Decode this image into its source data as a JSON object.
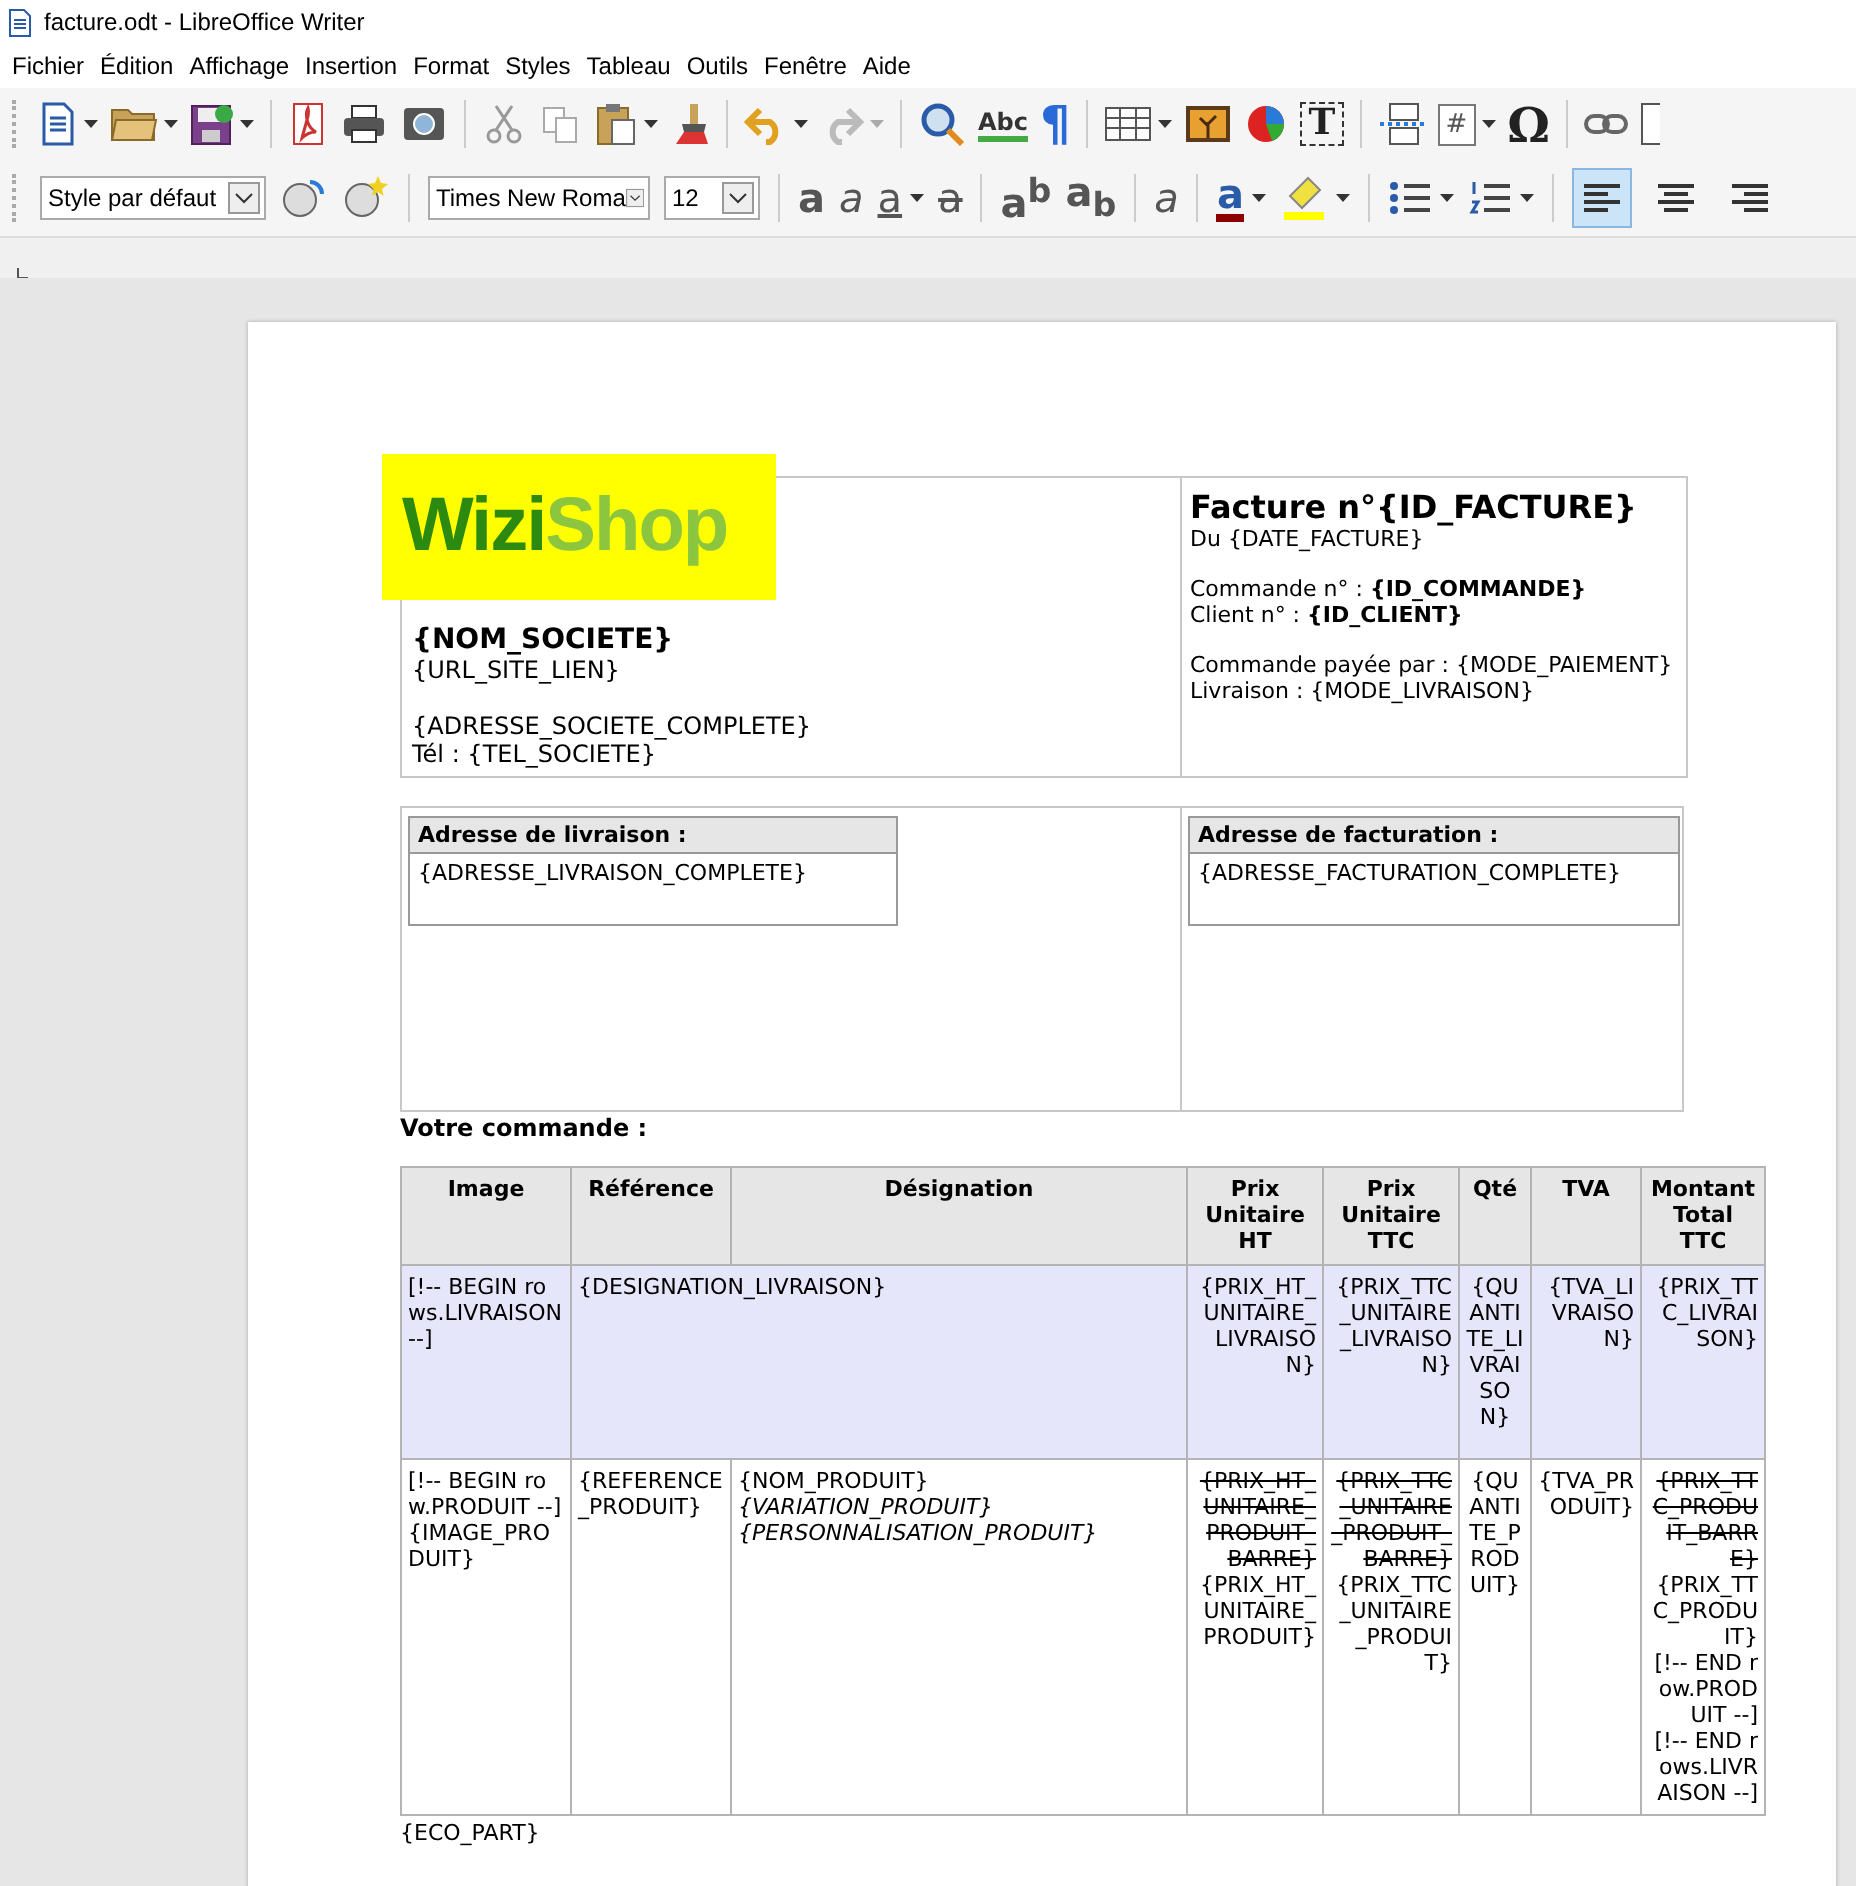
{
  "window": {
    "title": "facture.odt - LibreOffice Writer"
  },
  "menu": [
    "Fichier",
    "Édition",
    "Affichage",
    "Insertion",
    "Format",
    "Styles",
    "Tableau",
    "Outils",
    "Fenêtre",
    "Aide"
  ],
  "standard_toolbar": {
    "spellcheck": "Abc",
    "formatting_marks": "¶",
    "text_box": "T",
    "field": "#",
    "special_character": "Ω"
  },
  "formatting_toolbar": {
    "paragraph_style": "Style par défaut",
    "font_name": "Times New Roma",
    "font_size": "12",
    "text_buttons": [
      {
        "kind": "bold",
        "label": "a"
      },
      {
        "kind": "italic",
        "label": "a"
      },
      {
        "kind": "underline",
        "label": "a"
      },
      {
        "kind": "strike",
        "label": "a"
      }
    ],
    "script_buttons": [
      {
        "label": "a$^{b}$"
      },
      {
        "label": "a$_{b}$"
      }
    ],
    "clear_label": "a",
    "font_color_label": "a",
    "alignment": [
      {
        "selected": true
      },
      {
        "selected": false
      },
      {
        "selected": false
      }
    ]
  },
  "document": {
    "logo": {
      "part_1": "Wizi",
      "part_2": "Shop"
    },
    "company": {
      "name": "{NOM_SOCIETE}",
      "url": "{URL_SITE_LIEN}",
      "address": "{ADRESSE_SOCIETE_COMPLETE}",
      "phone": "Tél : {TEL_SOCIETE}"
    },
    "invoice": {
      "title": "Facture n°{ID_FACTURE}",
      "date": "Du  {DATE_FACTURE}",
      "order": "Commande n° : **{ID_COMMANDE}**",
      "client": "Client n° : **{ID_CLIENT}**",
      "payment": "Commande payée par : {MODE_PAIEMENT}",
      "shipping": "Livraison : {MODE_LIVRAISON}"
    },
    "addresses": [
      {
        "title": "Adresse de livraison :",
        "content": "{ADRESSE_LIVRAISON_COMPLETE}"
      },
      {
        "title": "Adresse de facturation :",
        "content": "{ADRESSE_FACTURATION_COMPLETE}"
      }
    ],
    "order_heading": "Votre commande :",
    "table": {
      "columns": [
        "Image",
        "Référence",
        "Désignation",
        "Prix Unitaire HT",
        "Prix Unitaire TTC",
        "Qté",
        "TVA",
        "Montant Total TTC"
      ],
      "rows": [
        {
          "shaded": true,
          "cells": [
            {
              "kind": "normal",
              "lines": [
                {
                  "kind": "plain",
                  "text": "[!-- BEGIN rows.LIVRAISON --]"
                }
              ]
            },
            {
              "kind": "normal",
              "colspan": 2,
              "lines": [
                {
                  "kind": "plain",
                  "text": "{DESIGNATION_LIVRAISON}"
                }
              ]
            },
            {
              "kind": "normal",
              "lines": [
                {
                  "kind": "plain",
                  "text": "{PRIX_HT_UNITAIRE_LIVRAISON}"
                }
              ]
            },
            {
              "kind": "normal",
              "lines": [
                {
                  "kind": "plain",
                  "text": "{PRIX_TTC_UNITAIRE_LIVRAISON}"
                }
              ]
            },
            {
              "kind": "normal",
              "lines": [
                {
                  "kind": "plain",
                  "text": "{QUANTITE_LIVRAISON}"
                }
              ]
            },
            {
              "kind": "normal",
              "lines": [
                {
                  "kind": "plain",
                  "text": "{TVA_LIVRAISON}"
                }
              ]
            },
            {
              "kind": "normal",
              "lines": [
                {
                  "kind": "plain",
                  "text": "{PRIX_TTC_LIVRAISON}"
                }
              ]
            }
          ]
        },
        {
          "shaded": false,
          "cells": [
            {
              "kind": "normal",
              "lines": [
                {
                  "kind": "plain",
                  "text": "[!-- BEGIN row.PRODUIT --]"
                },
                {
                  "kind": "plain",
                  "text": "{IMAGE_PRODUIT}"
                }
              ]
            },
            {
              "kind": "normal",
              "lines": [
                {
                  "kind": "plain",
                  "text": "{REFERENCE_PRODUIT}"
                }
              ]
            },
            {
              "kind": "normal",
              "lines": [
                {
                  "kind": "plain",
                  "text": "{NOM_PRODUIT}"
                },
                {
                  "kind": "italic",
                  "text": "{VARIATION_PRODUIT}"
                },
                {
                  "kind": "italic",
                  "text": "{PERSONNALISATION_PRODUIT}"
                }
              ]
            },
            {
              "kind": "normal",
              "lines": [
                {
                  "kind": "strike",
                  "text": "{PRIX_HT_UNITAIRE_PRODUIT_BARRE}"
                },
                {
                  "kind": "plain",
                  "text": "{PRIX_HT_UNITAIRE_PRODUIT}"
                }
              ]
            },
            {
              "kind": "normal",
              "lines": [
                {
                  "kind": "strike",
                  "text": "{PRIX_TTC_UNITAIRE_PRODUIT_BARRE}"
                },
                {
                  "kind": "plain",
                  "text": "{PRIX_TTC_UNITAIRE_PRODUIT}"
                }
              ]
            },
            {
              "kind": "normal",
              "lines": [
                {
                  "kind": "plain",
                  "text": "{QUANTITE_PRODUIT}"
                }
              ]
            },
            {
              "kind": "normal",
              "lines": [
                {
                  "kind": "plain",
                  "text": "{TVA_PRODUIT}"
                }
              ]
            },
            {
              "kind": "normal",
              "lines": [
                {
                  "kind": "strike",
                  "text": "{PRIX_TTC_PRODUIT_BARRE}"
                },
                {
                  "kind": "plain",
                  "text": "{PRIX_TTC_PRODUIT}"
                },
                {
                  "kind": "plain",
                  "text": "[!-- END row.PRODUIT --]"
                },
                {
                  "kind": "plain",
                  "text": "[!-- END rows.LIVRAISON --]"
                }
              ]
            }
          ]
        }
      ]
    },
    "footer": "{ECO_PART}"
  }
}
